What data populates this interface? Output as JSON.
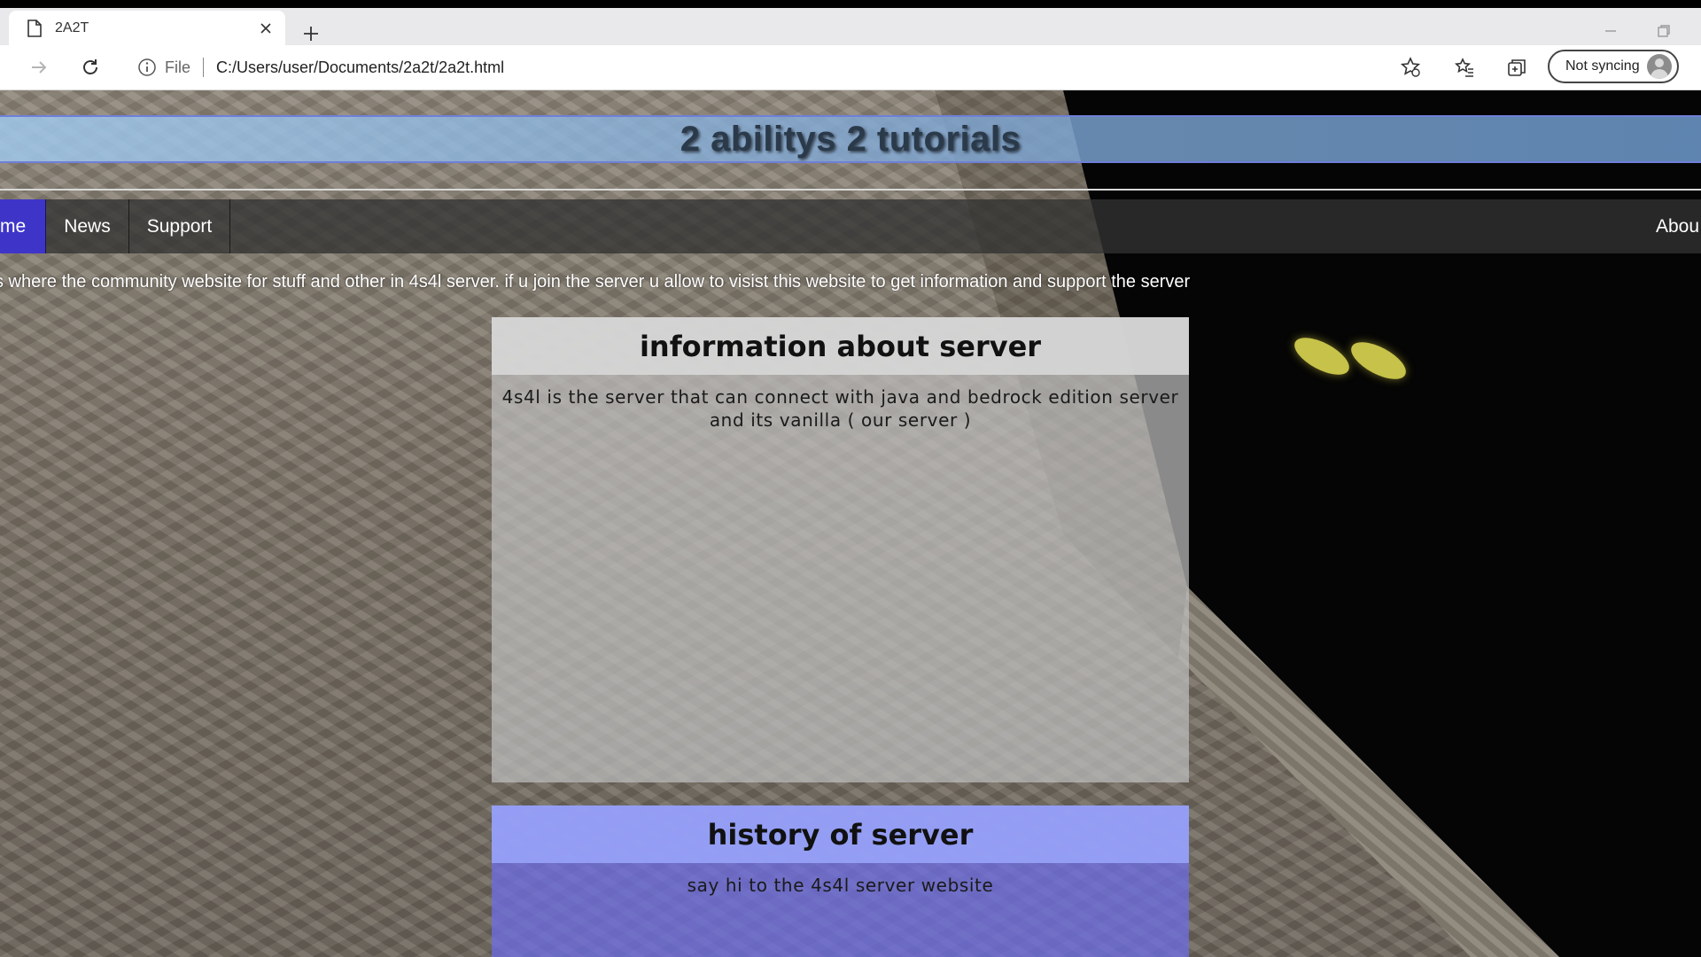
{
  "browser": {
    "tab_title": "2A2T",
    "address_scheme": "File",
    "url": "C:/Users/user/Documents/2a2t/2a2t.html",
    "sync_label": "Not syncing"
  },
  "site": {
    "title": "2 abilitys 2 tutorials",
    "nav": {
      "items": [
        "me",
        "News",
        "Support"
      ],
      "right_item": "Abou",
      "active_color": "#3e35c8"
    },
    "intro": "s where the community website for stuff and other in 4s4l server. if u join the server u allow to visist this website to get information and support the server",
    "panels": [
      {
        "heading": "information about server",
        "body": "4s4l is the server that can connect with java and bedrock edition server and its vanilla ( our server )"
      },
      {
        "heading": "history of server",
        "body": "say hi to the 4s4l server website"
      }
    ]
  },
  "icons": [
    "page-icon",
    "close-icon",
    "plus-icon",
    "minimize-icon",
    "restore-icon",
    "forward-icon",
    "refresh-icon",
    "info-icon",
    "add-favorite-icon",
    "favorites-icon",
    "collections-icon",
    "avatar"
  ]
}
